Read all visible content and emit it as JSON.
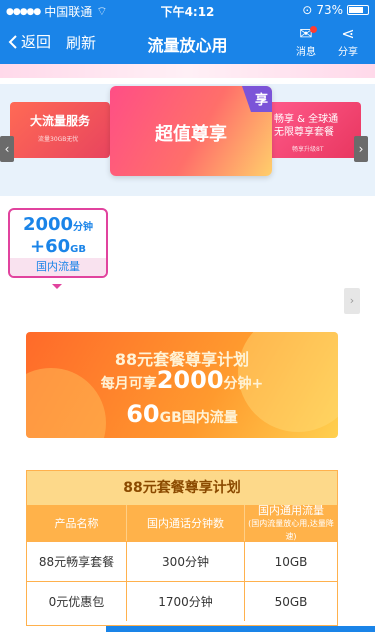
{
  "status_bar": {
    "carrier": "中国联通",
    "time": "下午4:12",
    "battery": "73%"
  },
  "nav": {
    "back": "返回",
    "refresh": "刷新",
    "title": "流量放心用",
    "message": "消息",
    "share": "分享"
  },
  "carousel": {
    "left_card": {
      "title": "大流量服务",
      "sub": "流量30GB无忧"
    },
    "main_card": {
      "title": "超值尊享",
      "badge": "享"
    },
    "right_card": {
      "line1": "畅享 & 全球通",
      "line2": "无限尊享套餐",
      "sub": "畅享升级8T"
    }
  },
  "package": {
    "minutes": "2000",
    "minutes_unit": "分钟",
    "data": "+60",
    "data_unit": "GB",
    "label": "国内流量"
  },
  "promo": {
    "title": "88元套餐尊享计划",
    "line2_prefix": "每月可享",
    "line2_value": "2000",
    "line2_suffix": "分钟+",
    "line3_value": "60",
    "line3_suffix": "GB国内流量"
  },
  "plan_table": {
    "title": "88元套餐尊享计划",
    "headers": [
      "产品名称",
      "国内通话分钟数",
      "国内通用流量"
    ],
    "header_note": "(国内流量放心用,达量降速)",
    "rows": [
      [
        "88元畅享套餐",
        "300分钟",
        "10GB"
      ],
      [
        "0元优惠包",
        "1700分钟",
        "50GB"
      ]
    ]
  },
  "colors": {
    "primary": "#1a84e8",
    "accent_pink": "#e1439e",
    "orange": "#ffb24a"
  }
}
